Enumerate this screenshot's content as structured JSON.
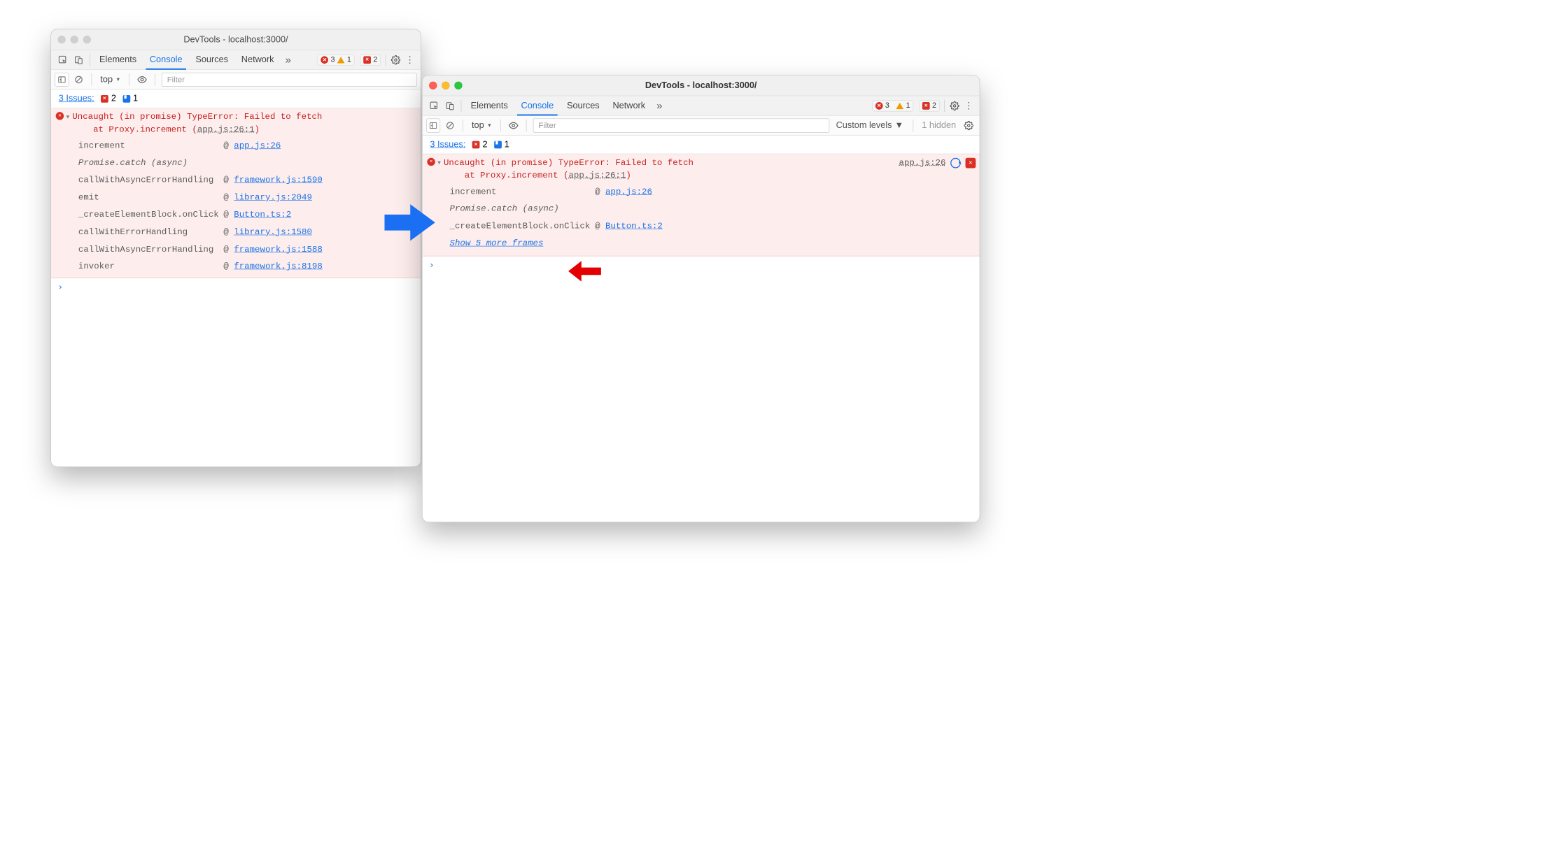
{
  "window_title": "DevTools - localhost:3000/",
  "tabs": {
    "elements": "Elements",
    "console": "Console",
    "sources": "Sources",
    "network": "Network"
  },
  "badges": {
    "errors": "3",
    "warnings": "1",
    "breaks": "2"
  },
  "subbar": {
    "context": "top",
    "filter_ph": "Filter",
    "levels": "Custom levels",
    "hidden": "1 hidden"
  },
  "issues": {
    "label": "3 Issues:",
    "x": "2",
    "m": "1"
  },
  "error": {
    "line1": "Uncaught (in promise) TypeError: Failed to fetch",
    "line2a": "at Proxy.increment (",
    "line2src": "app.js:26:1",
    "line2b": ")",
    "src_right": "app.js:26"
  },
  "show_more": "Show 5 more frames",
  "stack_left": [
    {
      "fn": "increment",
      "link": "app.js:26"
    },
    {
      "em": "Promise.catch (async)"
    },
    {
      "fn": "callWithAsyncErrorHandling",
      "link": "framework.js:1590"
    },
    {
      "fn": "emit",
      "link": "library.js:2049"
    },
    {
      "fn": "_createElementBlock.onClick",
      "link": "Button.ts:2"
    },
    {
      "fn": "callWithErrorHandling",
      "link": "library.js:1580"
    },
    {
      "fn": "callWithAsyncErrorHandling",
      "link": "framework.js:1588"
    },
    {
      "fn": "invoker",
      "link": "framework.js:8198"
    }
  ],
  "stack_right": [
    {
      "fn": "increment",
      "link": "app.js:26"
    },
    {
      "em": "Promise.catch (async)"
    },
    {
      "fn": "_createElementBlock.onClick",
      "link": "Button.ts:2"
    }
  ]
}
